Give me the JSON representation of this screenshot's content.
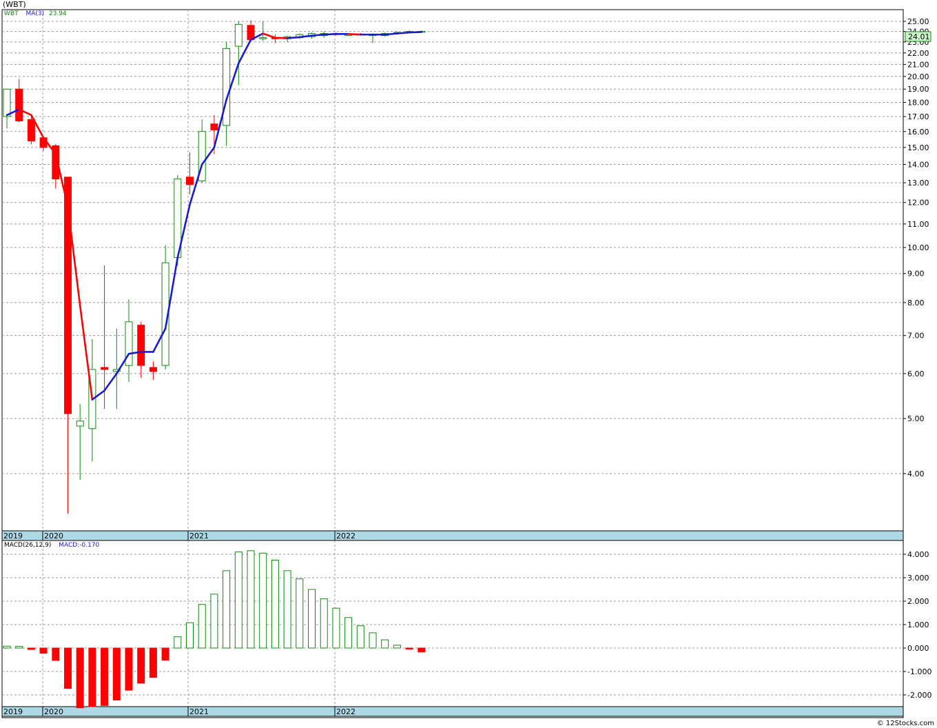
{
  "header": {
    "title": "(WBT)",
    "symbol": "WBT",
    "ma_label": "MA(3)",
    "ma_value": "23.94",
    "last_price_badge": "24.01"
  },
  "macd_legend": {
    "name": "MACD(26,12,9)",
    "value_label": "MACD:-0.170"
  },
  "watermark": "© 12Stocks.com",
  "colors": {
    "up": "#118811",
    "down": "#ff0000",
    "ma_up": "#1a1ad0",
    "ma_down": "#ff0000",
    "axis_band": "#add8e6",
    "badge": "#ccf5cc"
  },
  "chart_data": [
    {
      "type": "candlestick",
      "scale": "log",
      "ylim": [
        3.2,
        25.6
      ],
      "y_ticks": [
        "4.00",
        "5.00",
        "6.00",
        "7.00",
        "8.00",
        "9.00",
        "10.00",
        "11.00",
        "12.00",
        "13.00",
        "14.00",
        "15.00",
        "16.00",
        "17.00",
        "18.00",
        "19.00",
        "20.00",
        "21.00",
        "22.00",
        "23.00",
        "24.00",
        "25.00"
      ],
      "x_axis_labels": [
        "2019",
        "2020",
        "2021",
        "2022"
      ],
      "candles": [
        {
          "o": 17.0,
          "h": 19.0,
          "l": 16.2,
          "c": 19.0
        },
        {
          "o": 19.0,
          "h": 19.8,
          "l": 16.6,
          "c": 16.7
        },
        {
          "o": 16.8,
          "h": 17.1,
          "l": 15.2,
          "c": 15.4
        },
        {
          "o": 15.6,
          "h": 15.7,
          "l": 14.8,
          "c": 15.0
        },
        {
          "o": 15.1,
          "h": 15.2,
          "l": 12.7,
          "c": 13.2
        },
        {
          "o": 13.3,
          "h": 13.3,
          "l": 3.4,
          "c": 5.1
        },
        {
          "o": 4.85,
          "h": 5.3,
          "l": 3.9,
          "c": 4.95
        },
        {
          "o": 4.8,
          "h": 6.9,
          "l": 4.2,
          "c": 6.1
        },
        {
          "o": 6.15,
          "h": 9.3,
          "l": 5.2,
          "c": 6.1
        },
        {
          "o": 6.05,
          "h": 7.2,
          "l": 5.2,
          "c": 6.1
        },
        {
          "o": 6.2,
          "h": 8.1,
          "l": 5.8,
          "c": 7.4
        },
        {
          "o": 7.3,
          "h": 7.4,
          "l": 5.9,
          "c": 6.2
        },
        {
          "o": 6.15,
          "h": 6.3,
          "l": 5.85,
          "c": 6.05
        },
        {
          "o": 6.2,
          "h": 10.1,
          "l": 6.1,
          "c": 9.4
        },
        {
          "o": 9.6,
          "h": 13.4,
          "l": 9.3,
          "c": 13.2
        },
        {
          "o": 13.3,
          "h": 14.7,
          "l": 12.4,
          "c": 12.9
        },
        {
          "o": 13.1,
          "h": 16.8,
          "l": 13.0,
          "c": 16.0
        },
        {
          "o": 16.5,
          "h": 17.1,
          "l": 14.6,
          "c": 16.1
        },
        {
          "o": 16.4,
          "h": 23.0,
          "l": 15.1,
          "c": 22.4
        },
        {
          "o": 22.6,
          "h": 25.0,
          "l": 19.3,
          "c": 24.7
        },
        {
          "o": 24.6,
          "h": 25.1,
          "l": 23.2,
          "c": 23.2
        },
        {
          "o": 23.4,
          "h": 25.0,
          "l": 23.1,
          "c": 23.4
        },
        {
          "o": 23.4,
          "h": 23.7,
          "l": 22.9,
          "c": 23.3
        },
        {
          "o": 23.3,
          "h": 23.6,
          "l": 23.0,
          "c": 23.5
        },
        {
          "o": 23.4,
          "h": 23.8,
          "l": 23.3,
          "c": 23.7
        },
        {
          "o": 23.5,
          "h": 23.9,
          "l": 23.3,
          "c": 23.8
        },
        {
          "o": 23.6,
          "h": 24.0,
          "l": 23.4,
          "c": 23.8
        },
        {
          "o": 23.8,
          "h": 23.9,
          "l": 23.6,
          "c": 23.7
        },
        {
          "o": 23.7,
          "h": 23.8,
          "l": 23.6,
          "c": 23.7
        },
        {
          "o": 23.75,
          "h": 23.85,
          "l": 23.6,
          "c": 23.65
        },
        {
          "o": 23.6,
          "h": 23.8,
          "l": 22.9,
          "c": 23.7
        },
        {
          "o": 23.6,
          "h": 23.9,
          "l": 23.5,
          "c": 23.8
        },
        {
          "o": 23.8,
          "h": 24.0,
          "l": 23.7,
          "c": 23.9
        },
        {
          "o": 23.9,
          "h": 24.1,
          "l": 23.8,
          "c": 24.0
        },
        {
          "o": 24.0,
          "h": 24.1,
          "l": 23.9,
          "c": 24.01
        }
      ],
      "ma3": [
        17.1,
        17.5,
        17.1,
        15.6,
        14.6,
        11.8,
        7.9,
        5.4,
        5.6,
        6.0,
        6.5,
        6.55,
        6.55,
        7.2,
        9.6,
        11.9,
        14.0,
        15.0,
        18.2,
        21.1,
        23.2,
        23.8,
        23.4,
        23.35,
        23.45,
        23.6,
        23.7,
        23.75,
        23.75,
        23.7,
        23.7,
        23.7,
        23.8,
        23.9,
        23.94
      ]
    },
    {
      "type": "bar",
      "name": "MACD(26,12,9)",
      "ylim": [
        -2.5,
        4.4
      ],
      "y_ticks": [
        "-2.000",
        "-1.000",
        "0.000",
        "1.000",
        "2.000",
        "3.000",
        "4.000"
      ],
      "x_axis_labels": [
        "2019",
        "2020",
        "2021",
        "2022"
      ],
      "values": [
        0.08,
        0.07,
        -0.06,
        -0.22,
        -0.53,
        -1.72,
        -2.55,
        -2.5,
        -2.45,
        -2.22,
        -1.8,
        -1.5,
        -1.25,
        -0.52,
        0.48,
        1.08,
        1.86,
        2.3,
        3.3,
        4.1,
        4.15,
        4.05,
        3.75,
        3.3,
        2.95,
        2.5,
        2.1,
        1.7,
        1.3,
        0.95,
        0.65,
        0.35,
        0.12,
        -0.05,
        -0.17
      ]
    }
  ]
}
